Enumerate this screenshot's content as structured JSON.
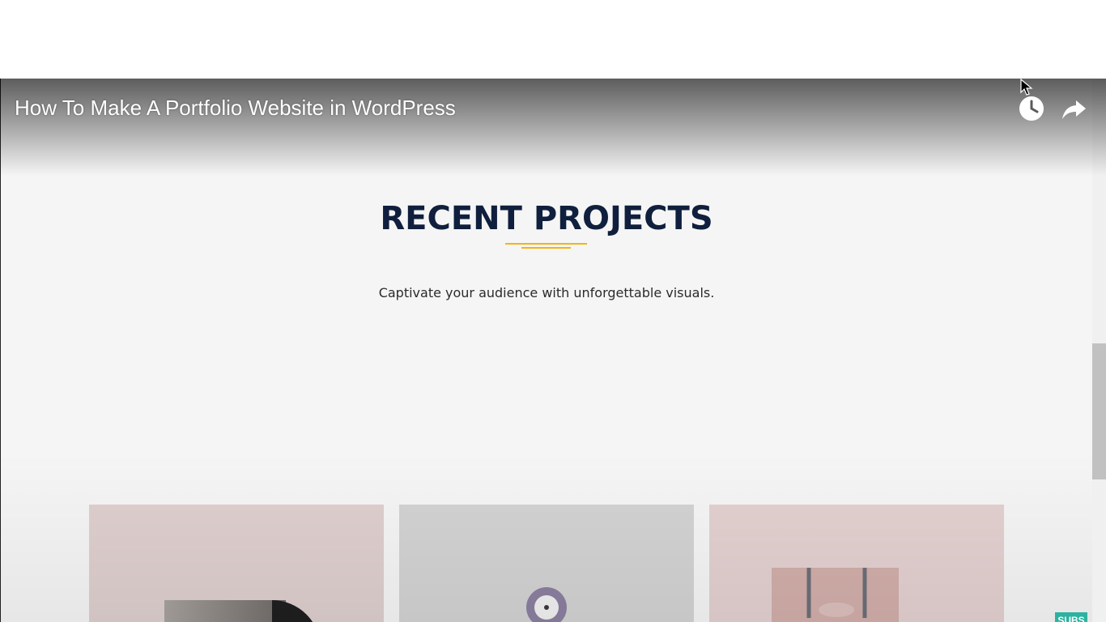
{
  "video": {
    "title": "How To Make A Portfolio Website in WordPress",
    "controls": {
      "watch_later_icon": "clock-icon",
      "share_icon": "share-arrow-icon"
    }
  },
  "page": {
    "section_title": "RECENT PROJECTS",
    "subtitle": "Captivate your audience with unforgettable visuals.",
    "accent_color": "#f2b416",
    "title_color": "#0f1f3d"
  },
  "projects": [
    {
      "image": "vinyl-record-mockup",
      "background": "#dfcfcf"
    },
    {
      "image": "round-badge-mockup",
      "background": "#d3d3d3"
    },
    {
      "image": "shopping-bag-mockup",
      "background": "#e3d1d0"
    }
  ],
  "badge": {
    "label": "SUBS"
  }
}
